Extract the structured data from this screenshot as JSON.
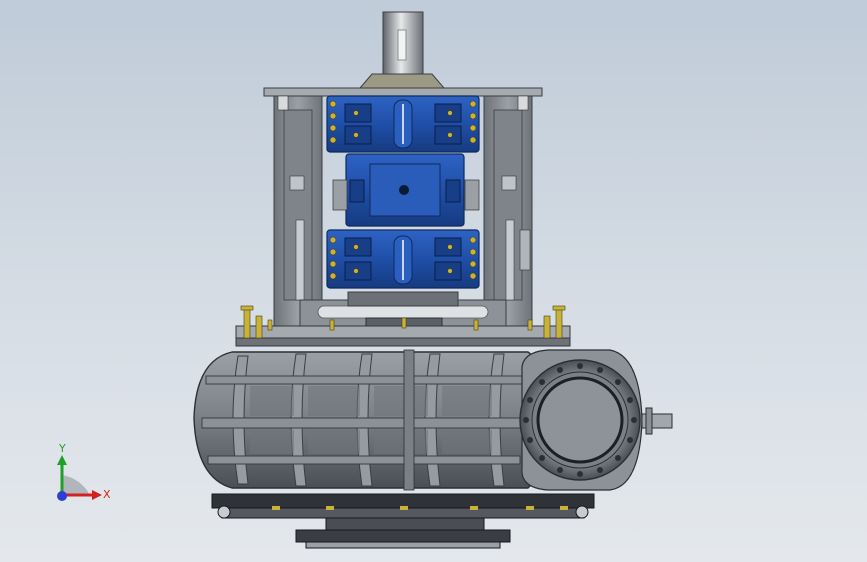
{
  "viewport": {
    "background_top": "#bfcbd8",
    "background_bottom": "#e4e8ec"
  },
  "model": {
    "metal_color": "#8a8f95",
    "dark_metal_color": "#3a3e44",
    "bearing_color": "#1f4fa8",
    "bolt_color": "#c9b23a"
  },
  "triad": {
    "x_label": "X",
    "y_label": "Y",
    "x_color": "#d42020",
    "y_color": "#1fa02a",
    "z_color": "#2a3fd4"
  }
}
